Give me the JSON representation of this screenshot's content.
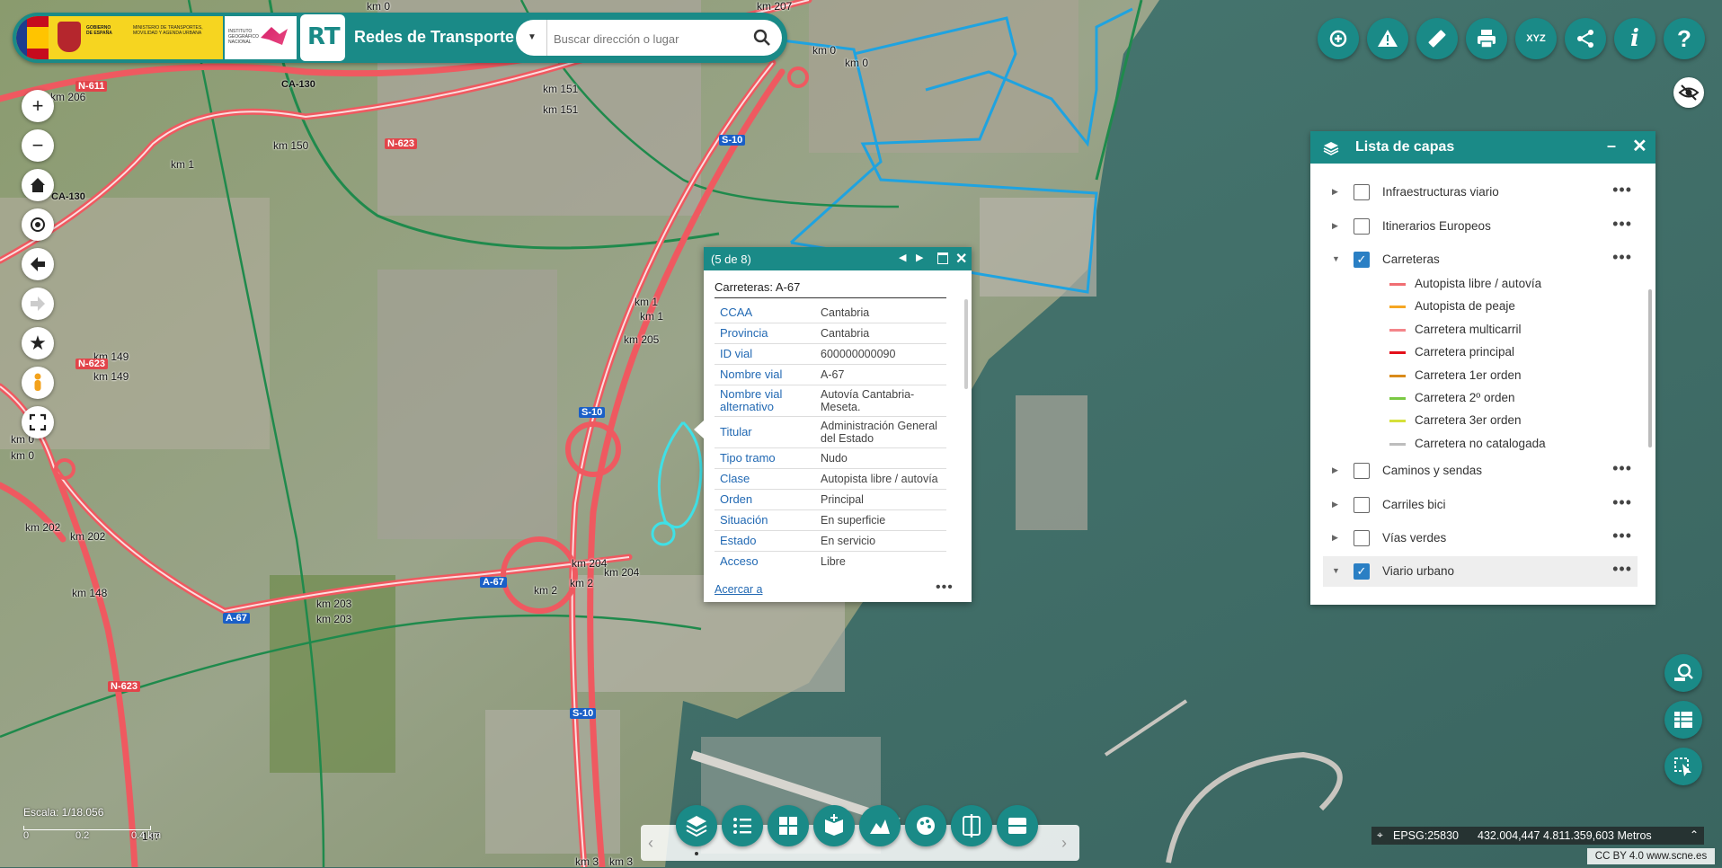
{
  "header": {
    "app_title": "Redes de Transporte",
    "gov_text": "GOBIERNO DE ESPAÑA",
    "ministry_text": "MINISTERIO DE TRANSPORTES, MOVILIDAD Y AGENDA URBANA",
    "ign_text": "INSTITUTO GEOGRÁFICO NACIONAL",
    "rt_logo": "RT",
    "search_placeholder": "Buscar dirección o lugar"
  },
  "top_tools": [
    {
      "icon": "add-location-icon"
    },
    {
      "icon": "warning-icon"
    },
    {
      "icon": "ruler-icon"
    },
    {
      "icon": "print-icon"
    },
    {
      "label": "XYZ",
      "icon": "coordinates-icon"
    },
    {
      "icon": "share-icon"
    },
    {
      "label": "i",
      "icon": "info-icon"
    },
    {
      "label": "?",
      "icon": "help-icon"
    }
  ],
  "layer_panel": {
    "title": "Lista de capas",
    "layers": [
      {
        "label": "Infraestructuras viario",
        "checked": false,
        "expanded": false
      },
      {
        "label": "Itinerarios Europeos",
        "checked": false,
        "expanded": false
      },
      {
        "label": "Carreteras",
        "checked": true,
        "expanded": true
      },
      {
        "label": "Caminos y sendas",
        "checked": false,
        "expanded": false
      },
      {
        "label": "Carriles bici",
        "checked": false,
        "expanded": false
      },
      {
        "label": "Vías verdes",
        "checked": false,
        "expanded": false
      },
      {
        "label": "Viario urbano",
        "checked": true,
        "expanded": true
      }
    ],
    "legend": [
      {
        "label": "Autopista libre / autovía",
        "color": "#f06e73"
      },
      {
        "label": "Autopista de peaje",
        "color": "#f5a623"
      },
      {
        "label": "Carretera multicarril",
        "color": "#f4858a"
      },
      {
        "label": "Carretera principal",
        "color": "#e3101a"
      },
      {
        "label": "Carretera 1er orden",
        "color": "#d98a1a"
      },
      {
        "label": "Carretera 2º orden",
        "color": "#7ac943"
      },
      {
        "label": "Carretera 3er orden",
        "color": "#d6e03a"
      },
      {
        "label": "Carretera no catalogada",
        "color": "#bdbdbd"
      }
    ]
  },
  "popup": {
    "count": "(5 de 8)",
    "title": "Carreteras: A-67",
    "rows": [
      {
        "key": "CCAA",
        "value": "Cantabria"
      },
      {
        "key": "Provincia",
        "value": "Cantabria"
      },
      {
        "key": "ID vial",
        "value": "600000000090"
      },
      {
        "key": "Nombre vial",
        "value": "A-67"
      },
      {
        "key": "Nombre vial alternativo",
        "value": "Autovía Cantabria-Meseta."
      },
      {
        "key": "Titular",
        "value": "Administración General del Estado"
      },
      {
        "key": "Tipo tramo",
        "value": "Nudo"
      },
      {
        "key": "Clase",
        "value": "Autopista libre / autovía"
      },
      {
        "key": "Orden",
        "value": "Principal"
      },
      {
        "key": "Situación",
        "value": "En superficie"
      },
      {
        "key": "Estado",
        "value": "En servicio"
      },
      {
        "key": "Acceso",
        "value": "Libre"
      }
    ],
    "zoom_link": "Acercar a"
  },
  "scale": {
    "label": "Escala: 1/18.056",
    "ticks": [
      "0",
      "0.2",
      "0.4 km"
    ]
  },
  "coordinates": {
    "crs": "EPSG:25830",
    "value": "432.004,447 4.811.359,603 Metros"
  },
  "credit": "CC BY 4.0 www.scne.es",
  "map_labels": {
    "km": [
      "km 207",
      "km 0",
      "km 0",
      "km 0",
      "km 151",
      "km 151",
      "km 206",
      "km 150",
      "km 1",
      "km 1",
      "km 1",
      "km 205",
      "km 149",
      "km 149",
      "km 0",
      "km 0",
      "km 202",
      "km 202",
      "km 148",
      "km 204",
      "km 204",
      "km 2",
      "km 2",
      "km 203",
      "km 203",
      "km 3",
      "km 3",
      "147"
    ],
    "roads": [
      "N-611",
      "CA-130",
      "N-623",
      "CA-130",
      "N-623",
      "N-623",
      "S-10",
      "S-10",
      "S-10",
      "A-67",
      "A-67"
    ]
  }
}
